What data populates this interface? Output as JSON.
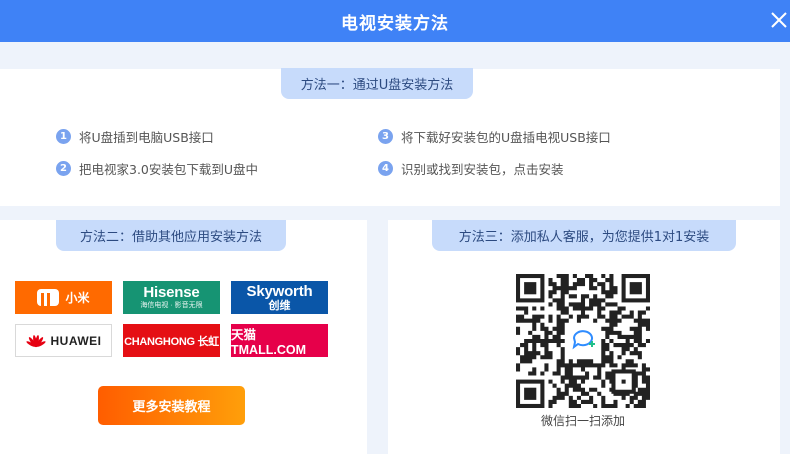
{
  "window": {
    "title": "电视安装方法",
    "close_icon": "close-icon"
  },
  "method1": {
    "title": "方法一：通过U盘安装方法",
    "steps": [
      {
        "num": "1",
        "text": "将U盘插到电脑USB接口"
      },
      {
        "num": "2",
        "text": "把电视家3.0安装包下载到U盘中"
      },
      {
        "num": "3",
        "text": "将下载好安装包的U盘插电视USB接口"
      },
      {
        "num": "4",
        "text": "识别或找到安装包，点击安装"
      }
    ]
  },
  "method2": {
    "title": "方法二：借助其他应用安装方法",
    "brands": {
      "xiaomi": "小米",
      "hisense": "Hisense",
      "hisense_sub": "海信电视 · 影音无限",
      "skyworth": "Skyworth",
      "skyworth_cn": "创维",
      "huawei": "HUAWEI",
      "changhong": "CHANGHONG 长虹",
      "tmall": "天猫 TMALL.COM"
    },
    "more_button": "更多安装教程"
  },
  "method3": {
    "title": "方法三：添加私人客服，为您提供1对1安装",
    "qr_caption": "微信扫一扫添加"
  },
  "colors": {
    "header": "#3f82f6",
    "pill": "#c7dbfb",
    "step_badge": "#7aa3ef",
    "button_start": "#ff5d00",
    "button_end": "#ff9f0a"
  }
}
